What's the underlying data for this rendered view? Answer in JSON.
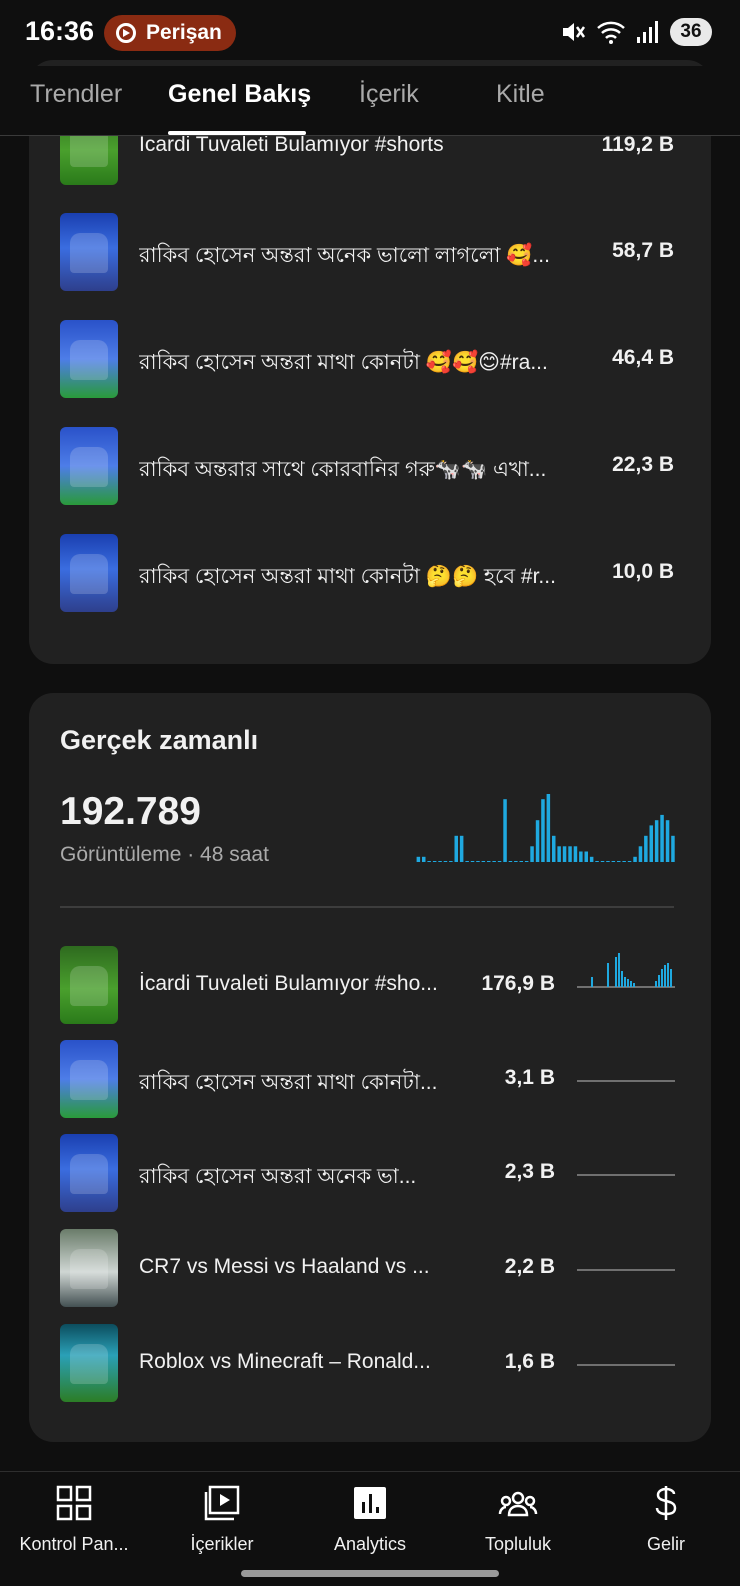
{
  "status_bar": {
    "time": "16:36",
    "recording_label": "Perişan",
    "battery": "36",
    "icons": [
      "mute-icon",
      "wifi-icon",
      "signal-icon"
    ]
  },
  "tabs": [
    {
      "label": "Trendler",
      "active": false
    },
    {
      "label": "Genel Bakış",
      "active": true
    },
    {
      "label": "İçerik",
      "active": false
    },
    {
      "label": "Kitle",
      "active": false
    }
  ],
  "top_videos": [
    {
      "title": "Icardi Tuvaleti Bulamıyor #shorts",
      "value": "119,2 B"
    },
    {
      "title": "রাকিব হোসেন অন্তরা অনেক ভালো লাগলো 🥰...",
      "value": "58,7 B"
    },
    {
      "title": "রাকিব হোসেন অন্তরা মাথা কোনটা 🥰🥰😊#ra...",
      "value": "46,4 B"
    },
    {
      "title": "রাকিব অন্তরার সাথে কোরবানির গরু🐄🐄 এখা...",
      "value": "22,3 B"
    },
    {
      "title": "রাকিব হোসেন অন্তরা মাথা কোনটা 🤔🤔 হবে #r...",
      "value": "10,0 B"
    }
  ],
  "realtime": {
    "heading": "Gerçek zamanlı",
    "total": "192.789",
    "subtitle": "Görüntüleme · 48 saat",
    "videos": [
      {
        "title": "İcardi Tuvaleti Bulamıyor #sho...",
        "value": "176,9 B"
      },
      {
        "title": "রাকিব হোসেন অন্তরা মাথা কোনটা...",
        "value": "3,1 B"
      },
      {
        "title": "রাকিব হোসেন অন্তরা অনেক ভা...",
        "value": "2,3 B"
      },
      {
        "title": "CR7 vs Messi vs Haaland vs ...",
        "value": "2,2 B"
      },
      {
        "title": "Roblox vs Minecraft – Ronald...",
        "value": "1,6 B"
      }
    ],
    "main_bars": [
      1,
      1,
      0,
      0,
      0,
      0,
      0,
      5,
      5,
      0,
      0,
      0,
      0,
      0,
      0,
      0,
      12,
      0,
      0,
      0,
      0,
      3,
      8,
      12,
      13,
      5,
      3,
      3,
      3,
      3,
      2,
      2,
      1,
      0,
      0,
      0,
      0,
      0,
      0,
      0,
      1,
      3,
      5,
      7,
      8,
      9,
      8,
      5
    ],
    "accent_color": "#1fa9e0"
  },
  "bottom_nav": [
    {
      "label": "Kontrol Pan...",
      "icon": "dashboard-icon"
    },
    {
      "label": "İçerikler",
      "icon": "content-icon"
    },
    {
      "label": "Analytics",
      "icon": "analytics-icon"
    },
    {
      "label": "Topluluk",
      "icon": "community-icon"
    },
    {
      "label": "Gelir",
      "icon": "dollar-icon"
    }
  ]
}
